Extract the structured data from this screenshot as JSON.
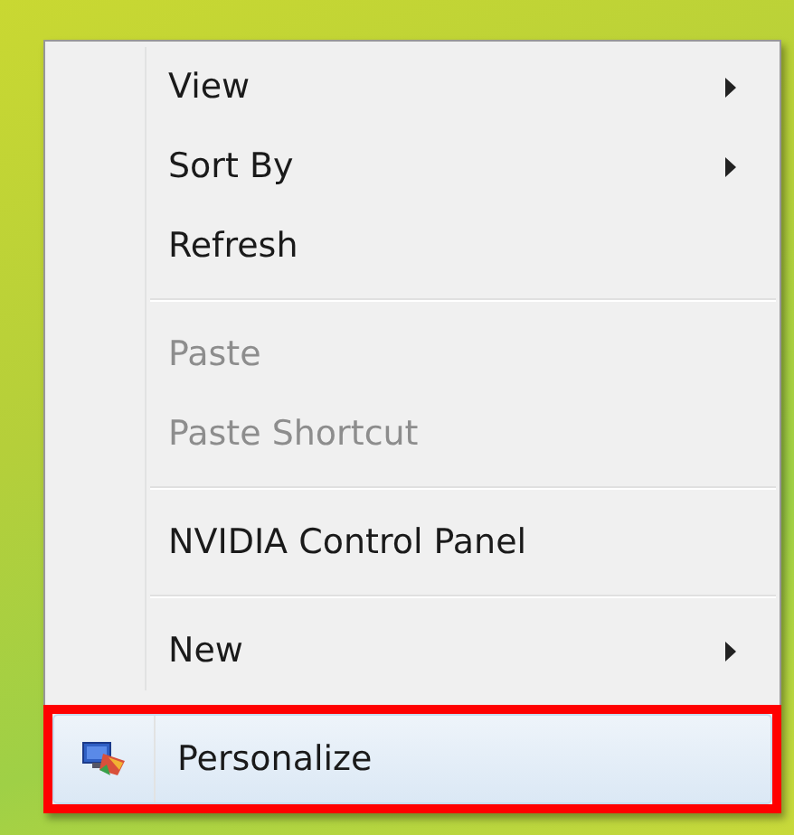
{
  "context_menu": {
    "items": [
      {
        "kind": "item",
        "label": "View",
        "disabled": false,
        "submenu": true,
        "selected": false
      },
      {
        "kind": "item",
        "label": "Sort By",
        "disabled": false,
        "submenu": true,
        "selected": false
      },
      {
        "kind": "item",
        "label": "Refresh",
        "disabled": false,
        "submenu": false,
        "selected": false
      },
      {
        "kind": "separator"
      },
      {
        "kind": "item",
        "label": "Paste",
        "disabled": true,
        "submenu": false,
        "selected": false
      },
      {
        "kind": "item",
        "label": "Paste Shortcut",
        "disabled": true,
        "submenu": false,
        "selected": false
      },
      {
        "kind": "separator"
      },
      {
        "kind": "item",
        "label": "NVIDIA Control Panel",
        "disabled": false,
        "submenu": false,
        "selected": false
      },
      {
        "kind": "separator"
      },
      {
        "kind": "item",
        "label": "New",
        "disabled": false,
        "submenu": true,
        "selected": false
      },
      {
        "kind": "item",
        "label": "Personalize",
        "disabled": false,
        "submenu": false,
        "selected": true,
        "icon": true
      }
    ]
  }
}
